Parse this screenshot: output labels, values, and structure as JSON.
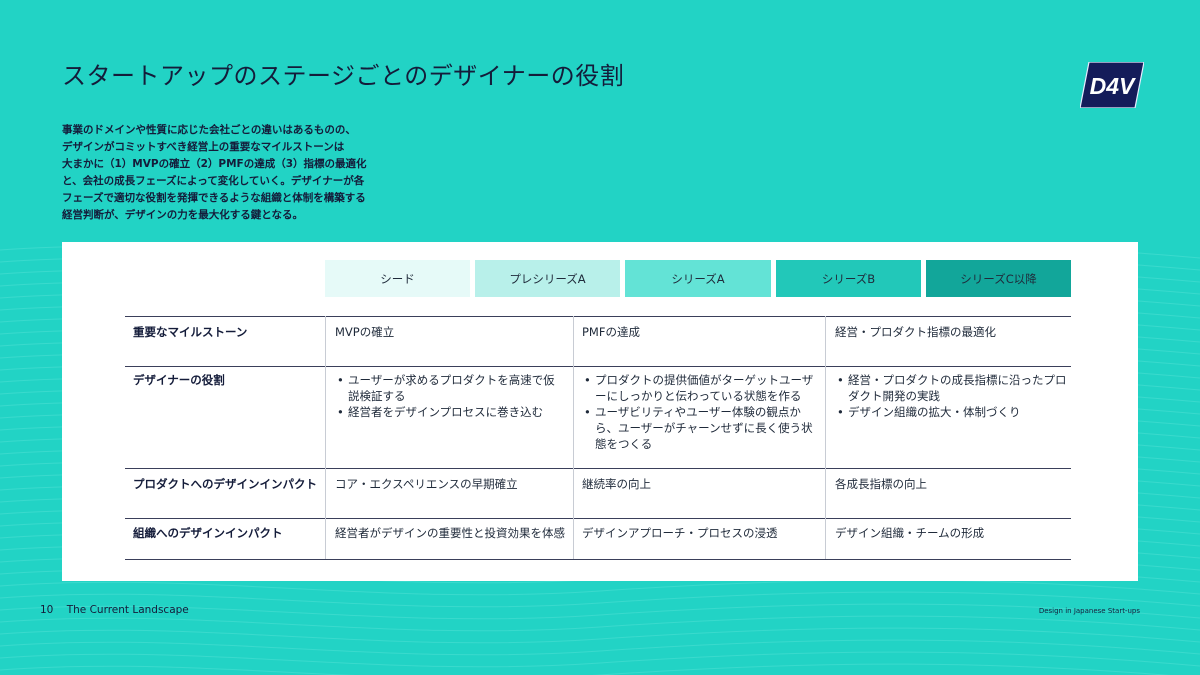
{
  "title": "スタートアップのステージごとのデザイナーの役割",
  "logo_text": "D4V",
  "intro_lines": [
    "事業のドメインや性質に応じた会社ごとの違いはあるものの、",
    "デザインがコミットすべき経営上の重要なマイルストーンは",
    "大まかに（1）MVPの確立（2）PMFの達成（3）指標の最適化",
    "と、会社の成長フェーズによって変化していく。デザイナーが各",
    "フェーズで適切な役割を発揮できるような組織と体制を構築する",
    "経営判断が、デザインの力を最大化する鍵となる。"
  ],
  "stages": [
    {
      "label": "シード",
      "color": "#e6faf8"
    },
    {
      "label": "プレシリーズA",
      "color": "#b8f0ea"
    },
    {
      "label": "シリーズA",
      "color": "#63e3d6"
    },
    {
      "label": "シリーズB",
      "color": "#22c8b9"
    },
    {
      "label": "シリーズC以降",
      "color": "#12a69a"
    }
  ],
  "table": {
    "rows": [
      {
        "header": "重要なマイルストーン",
        "cells": [
          "MVPの確立",
          "PMFの達成",
          "経営・プロダクト指標の最適化"
        ]
      },
      {
        "header": "デザイナーの役割",
        "bullets": [
          [
            "ユーザーが求めるプロダクトを高速で仮説検証する",
            "経営者をデザインプロセスに巻き込む"
          ],
          [
            "プロダクトの提供価値がターゲットユーザーにしっかりと伝わっている状態を作る",
            "ユーザビリティやユーザー体験の観点から、ユーザーがチャーンせずに長く使う状態をつくる"
          ],
          [
            "経営・プロダクトの成長指標に沿ったプロダクト開発の実践",
            "デザイン組織の拡大・体制づくり"
          ]
        ]
      },
      {
        "header": "プロダクトへのデザインインパクト",
        "cells": [
          "コア・エクスペリエンスの早期確立",
          "継続率の向上",
          "各成長指標の向上"
        ]
      },
      {
        "header": "組織へのデザインインパクト",
        "cells": [
          "経営者がデザインの重要性と投資効果を体感",
          "デザインアプローチ・プロセスの浸透",
          "デザイン組織・チームの形成"
        ]
      }
    ]
  },
  "footer": {
    "page_number": "10",
    "section": "The Current Landscape",
    "right": "Design in Japanese Start-ups"
  },
  "colors": {
    "background": "#22d3c5",
    "card": "#ffffff",
    "logo_bg": "#141c5a",
    "text": "#141c3a"
  }
}
